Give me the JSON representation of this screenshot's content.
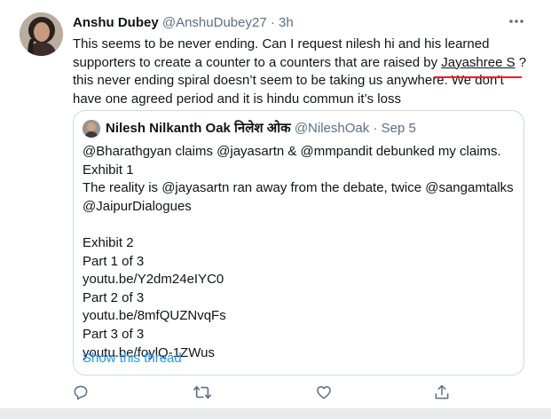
{
  "tweet": {
    "author_name": "Anshu Dubey",
    "author_handle": "@AnshuDubey27",
    "separator": "·",
    "time": "3h",
    "lines": [
      "This seems to be never ending. Can I request nilesh hi and his learned",
      "supporters to create a counter to a counters that are raised by ",
      "this never ending spiral doesn’t seem to be taking us anywhere. We don’t",
      "have one agreed period and it is hindu commun it’s  loss"
    ],
    "mention": "Jayashree S",
    "mention_suffix": " ?"
  },
  "quote": {
    "author_name": "Nilesh Nilkanth Oak निलेश ओक",
    "author_handle": "@NileshOak",
    "separator": "·",
    "date": "Sep 5",
    "lines": [
      "@Bharathgyan claims @jayasartn & @mmpandit debunked my claims.",
      "Exhibit 1",
      "The reality is @jayasartn ran away from the debate, twice @sangamtalks",
      "@JaipurDialogues",
      "",
      "Exhibit 2",
      "Part 1 of 3",
      "youtu.be/Y2dm24eIYC0",
      "Part 2 of 3",
      "youtu.be/8mfQUZNvqFs",
      "Part 3 of 3",
      "youtu.be/foylQ-1ZWus"
    ],
    "show_thread": "Show this thread"
  },
  "icons": {
    "more": "more-icon",
    "reply": "reply-icon",
    "retweet": "retweet-icon",
    "like": "like-icon",
    "share": "share-icon"
  },
  "colors": {
    "link": "#1d9bf0",
    "muted": "#5b7083",
    "annotation": "#e0242f"
  }
}
